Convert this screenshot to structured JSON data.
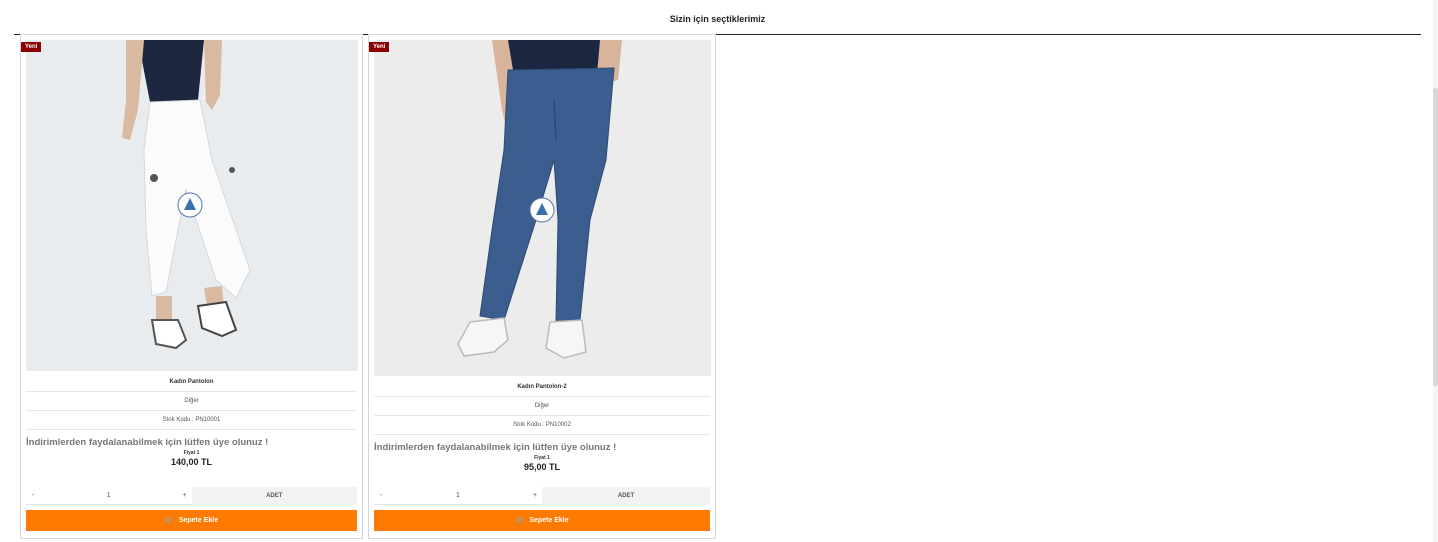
{
  "section": {
    "title": "Sizin için seçtiklerimiz"
  },
  "products": [
    {
      "badge": "Yeni",
      "name": "Kadın Pantolon",
      "category": "Diğer",
      "stock_code": "Stok Kodu : PN10001",
      "member_note": "İndirimlerden faydalanabilmek için lütfen üye olunuz !",
      "price_label": "Fiyat 1",
      "price": "140,00 TL",
      "qty_minus": "-",
      "qty": "1",
      "qty_plus": "+",
      "unit": "ADET",
      "cart_label": "Sepete Ekle"
    },
    {
      "badge": "Yeni",
      "name": "Kadın Pantolon-2",
      "category": "Diğer",
      "stock_code": "Stok Kodu : PN10002",
      "member_note": "İndirimlerden faydalanabilmek için lütfen üye olunuz !",
      "price_label": "Fiyat 1",
      "price": "95,00 TL",
      "qty_minus": "-",
      "qty": "1",
      "qty_plus": "+",
      "unit": "ADET",
      "cart_label": "Sepete Ekle"
    }
  ],
  "colors": {
    "accent": "#ff7a00",
    "badge": "#8b0000"
  },
  "icons": {
    "cart": "shopping-cart-icon"
  }
}
